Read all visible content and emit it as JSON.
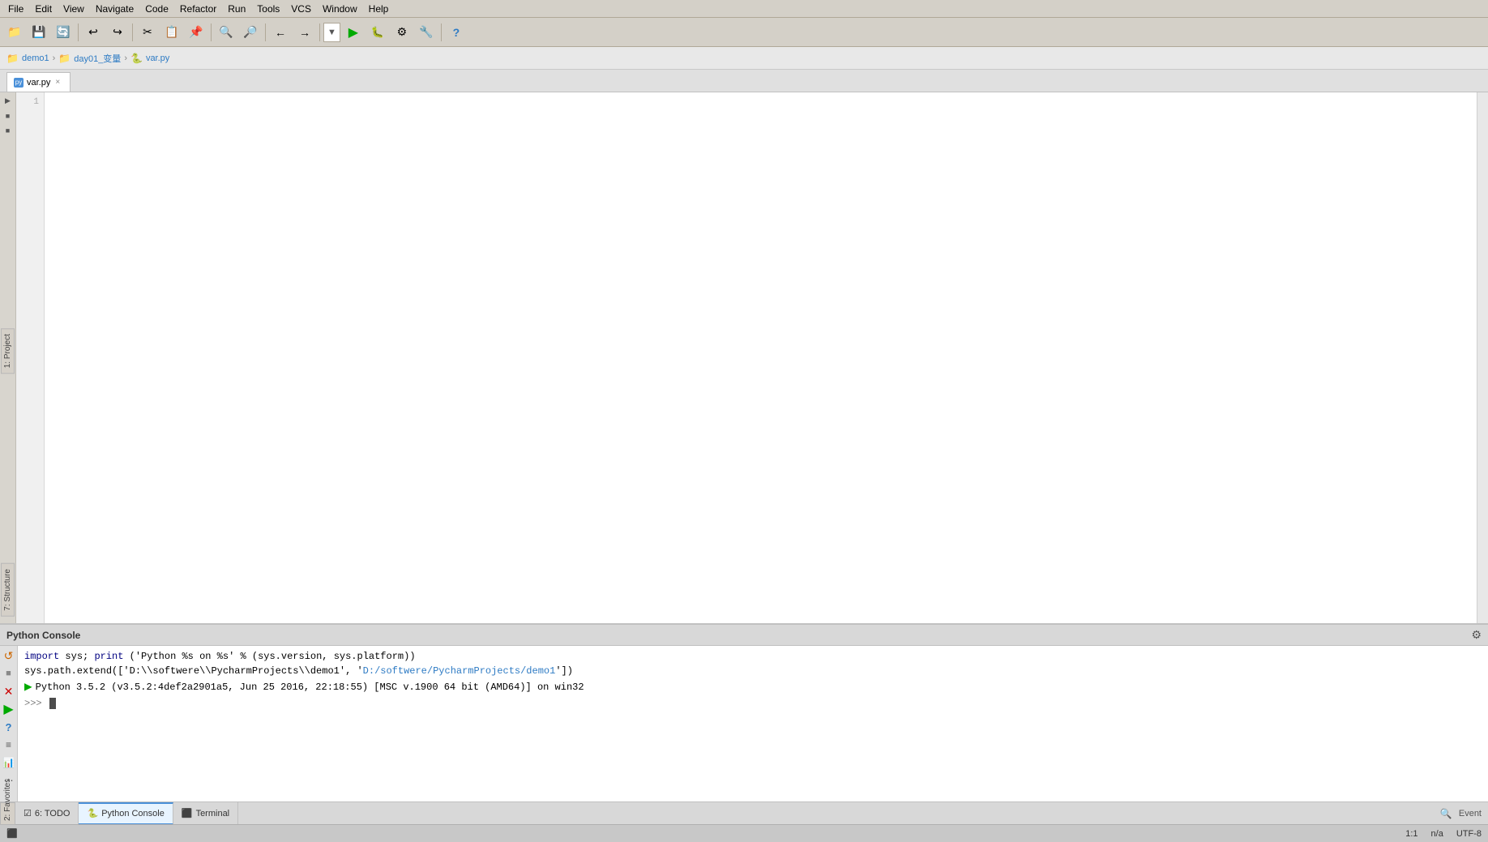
{
  "menubar": {
    "items": [
      "File",
      "Edit",
      "View",
      "Navigate",
      "Code",
      "Refactor",
      "Run",
      "Tools",
      "VCS",
      "Window",
      "Help"
    ]
  },
  "toolbar": {
    "buttons": [
      {
        "name": "open-folder",
        "icon": "📁"
      },
      {
        "name": "save",
        "icon": "💾"
      },
      {
        "name": "sync",
        "icon": "🔄"
      },
      {
        "name": "undo",
        "icon": "↩"
      },
      {
        "name": "redo",
        "icon": "↪"
      },
      {
        "name": "cut",
        "icon": "✂"
      },
      {
        "name": "copy",
        "icon": "📋"
      },
      {
        "name": "paste",
        "icon": "📌"
      },
      {
        "name": "find",
        "icon": "🔍"
      },
      {
        "name": "find-usages",
        "icon": "🔎"
      },
      {
        "name": "back",
        "icon": "←"
      },
      {
        "name": "forward",
        "icon": "→"
      },
      {
        "name": "dropdown",
        "icon": "▼"
      },
      {
        "name": "run",
        "icon": "▶"
      },
      {
        "name": "debug",
        "icon": "🐛"
      },
      {
        "name": "profile",
        "icon": "⚙"
      },
      {
        "name": "tools",
        "icon": "🔧"
      },
      {
        "name": "help",
        "icon": "?"
      }
    ]
  },
  "breadcrumb": {
    "items": [
      {
        "label": "demo1",
        "icon": "📁"
      },
      {
        "label": "day01_变量",
        "icon": "📁"
      },
      {
        "label": "var.py",
        "icon": "🐍"
      }
    ]
  },
  "tabs": [
    {
      "label": "var.py",
      "icon": "🐍",
      "active": true,
      "closable": true
    }
  ],
  "left_sidebar": {
    "project_label": "1: Project",
    "structure_label": "7: Structure",
    "icons": [
      "▶",
      "■",
      "■"
    ]
  },
  "editor": {
    "content": "",
    "line_count": 1
  },
  "console": {
    "title": "Python Console",
    "lines": [
      {
        "type": "code",
        "text": "import sys; print('Python %s on %s' % (sys.version, sys.platform))"
      },
      {
        "type": "code",
        "text": "sys.path.extend(['D:\\\\softwere\\\\PycharmProjects\\\\demo1', 'D:/softwere/PycharmProjects/demo1'])"
      },
      {
        "type": "output",
        "text": "Python 3.5.2 (v3.5.2:4def2a2901a5, Jun 25 2016, 22:18:55) [MSC v.1900 64 bit (AMD64)] on win32"
      },
      {
        "type": "prompt",
        "text": ">>>"
      }
    ],
    "sidebar_icons": [
      "↺",
      "■",
      "✕",
      "▶",
      "?",
      "≡",
      "📊",
      "⋯"
    ]
  },
  "bottom_tabs": [
    {
      "label": "6: TODO",
      "icon": "☑",
      "active": false
    },
    {
      "label": "Python Console",
      "icon": "🐍",
      "active": true
    },
    {
      "label": "Terminal",
      "icon": "⬛",
      "active": false
    }
  ],
  "status_bar": {
    "left": "",
    "position": "1:1",
    "selection": "n/a",
    "encoding": "UTF-8",
    "event": "Event"
  },
  "bottom_right_tabs": [
    {
      "label": "2: Favorites",
      "icon": "★"
    }
  ]
}
